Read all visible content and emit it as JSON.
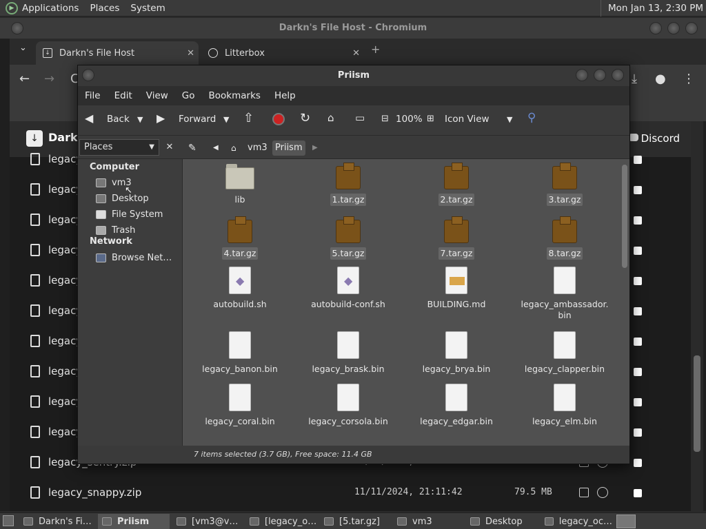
{
  "top_panel": {
    "menus": [
      "Applications",
      "Places",
      "System"
    ],
    "clock": "Mon Jan 13,  2:30 PM"
  },
  "browser": {
    "title": "Darkn's File Host - Chromium",
    "tabs": [
      {
        "label": "Darkn's File Host",
        "icon": "download-icon"
      },
      {
        "label": "Litterbox",
        "icon": "litterbox-icon"
      }
    ]
  },
  "website": {
    "name": "Darkn",
    "discord": "Discord",
    "rows": [
      {
        "name": "legacy",
        "date": "",
        "size": ""
      },
      {
        "name": "legacy",
        "date": "",
        "size": ""
      },
      {
        "name": "legacy",
        "date": "",
        "size": ""
      },
      {
        "name": "legacy",
        "date": "",
        "size": ""
      },
      {
        "name": "legacy",
        "date": "",
        "size": ""
      },
      {
        "name": "legacy",
        "date": "",
        "size": ""
      },
      {
        "name": "legacy",
        "date": "",
        "size": ""
      },
      {
        "name": "legacy",
        "date": "",
        "size": ""
      },
      {
        "name": "legacy",
        "date": "",
        "size": ""
      },
      {
        "name": "legacy",
        "date": "",
        "size": ""
      },
      {
        "name": "legacy_sentry.zip",
        "date": "11/11/2024, 21:08:10",
        "size": "79.4 MB"
      },
      {
        "name": "legacy_snappy.zip",
        "date": "11/11/2024, 21:11:42",
        "size": "79.5 MB"
      }
    ]
  },
  "file_manager": {
    "title": "Priism",
    "menu": [
      "File",
      "Edit",
      "View",
      "Go",
      "Bookmarks",
      "Help"
    ],
    "toolbar": {
      "back": "Back",
      "forward": "Forward",
      "zoom": "100%",
      "view_mode": "Icon View"
    },
    "places_select": "Places",
    "breadcrumb": [
      "vm3",
      "Priism"
    ],
    "sidebar": {
      "computer_heading": "Computer",
      "computer_items": [
        "vm3",
        "Desktop",
        "File System",
        "Trash"
      ],
      "network_heading": "Network",
      "network_items": [
        "Browse Net…"
      ]
    },
    "files": [
      {
        "name": "lib",
        "type": "folder",
        "selected": false
      },
      {
        "name": "1.tar.gz",
        "type": "archive",
        "selected": true
      },
      {
        "name": "2.tar.gz",
        "type": "archive",
        "selected": true
      },
      {
        "name": "3.tar.gz",
        "type": "archive",
        "selected": true
      },
      {
        "name": "4.tar.gz",
        "type": "archive",
        "selected": true
      },
      {
        "name": "5.tar.gz",
        "type": "archive",
        "selected": true
      },
      {
        "name": "7.tar.gz",
        "type": "archive",
        "selected": true
      },
      {
        "name": "8.tar.gz",
        "type": "archive",
        "selected": true
      },
      {
        "name": "autobuild.sh",
        "type": "script",
        "selected": false
      },
      {
        "name": "autobuild-conf.sh",
        "type": "script",
        "selected": false
      },
      {
        "name": "BUILDING.md",
        "type": "markdown",
        "selected": false
      },
      {
        "name": "legacy_ambassador.\nbin",
        "type": "file",
        "selected": false
      },
      {
        "name": "legacy_banon.bin",
        "type": "file",
        "selected": false
      },
      {
        "name": "legacy_brask.bin",
        "type": "file",
        "selected": false
      },
      {
        "name": "legacy_brya.bin",
        "type": "file",
        "selected": false
      },
      {
        "name": "legacy_clapper.bin",
        "type": "file",
        "selected": false
      },
      {
        "name": "legacy_coral.bin",
        "type": "file",
        "selected": false
      },
      {
        "name": "legacy_corsola.bin",
        "type": "file",
        "selected": false
      },
      {
        "name": "legacy_edgar.bin",
        "type": "file",
        "selected": false
      },
      {
        "name": "legacy_elm.bin",
        "type": "file",
        "selected": false
      }
    ],
    "status": "7 items selected (3.7 GB), Free space: 11.4 GB"
  },
  "taskbar": [
    {
      "label": "Darkn's Fi…",
      "active": false
    },
    {
      "label": "Priism",
      "active": true
    },
    {
      "label": "[vm3@v…",
      "active": false
    },
    {
      "label": "[legacy_o…",
      "active": false
    },
    {
      "label": "[5.tar.gz]",
      "active": false
    },
    {
      "label": "vm3",
      "active": false
    },
    {
      "label": "Desktop",
      "active": false
    },
    {
      "label": "legacy_oc…",
      "active": false
    }
  ]
}
